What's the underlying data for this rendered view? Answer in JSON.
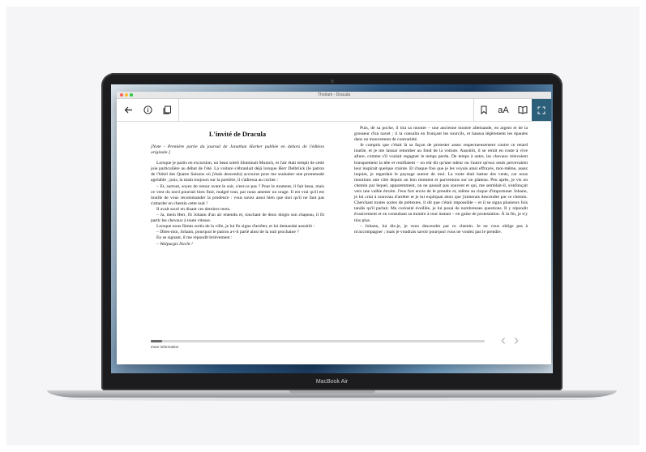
{
  "window": {
    "title": "Thorium - Dracula"
  },
  "toolbar": {
    "back_icon": "arrow-left-icon",
    "info_icon": "info-icon",
    "toc_icon": "library-icon",
    "bookmark_icon": "bookmark-icon",
    "text_settings_label": "aA",
    "reading_mode_icon": "book-open-icon",
    "fullscreen_icon": "fullscreen-icon"
  },
  "book": {
    "left_page": {
      "chapter_title": "L'invité de Dracula",
      "note": "[Note - Première partie du journal de Jonathan Harker publiée en dehors de l'édition originale.]",
      "paragraphs": [
        "Lorsque je partis en excursion, un beau soleil illuminait Munich, et l'air était rempli de cette joie particulière au début de l'été. La voiture s'ébranlait déjà lorsque Herr Delbrück (le patron de l'hôtel des Quatre Saisons où j'étais descendu) accourut pour me souhaiter une promenade agréable ; puis, la main toujours sur la portière, il s'adressa au cocher :",
        "– Et, surtout, soyez de retour avant le soir, n'est-ce pas ? Pour le moment, il fait beau, mais ce vent du nord pourrait bien finir, malgré tout, par nous amener un orage. Il est vrai qu'il est inutile de vous recommander la prudence : vous savez aussi bien que moi qu'il ne faut pas s'attarder en chemin cette nuit !",
        "Il avait souri en disant ces derniers mots.",
        "– Ja, mein Herr, fit Johann d'un air entendu et, touchant de deux doigts son chapeau, il fit partir les chevaux à toute vitesse.",
        "Lorsque nous fûmes sortis de la ville, je lui fis signe d'arrêter, et lui demandai aussitôt :",
        "– Dites-moi, Johann, pourquoi le patron a-t-il parlé ainsi de la nuit prochaine ?",
        "En se signant, il me répondit brièvement :",
        "– Walpurgis Nacht !"
      ]
    },
    "right_page": {
      "paragraphs": [
        "Puis, de sa poche, il tira sa montre – une ancienne montre allemande, en argent et de la grosseur d'un navet ; il la consulta en fronçant les sourcils, et haussa légèrement les épaules dans un mouvement de contrariété.",
        "Je compris que c'était là sa façon de protester assez respectueusement contre ce retard inutile, et je me laissai retomber au fond de la voiture. Aussitôt, il se remit en route à vive allure, comme s'il voulait regagner le temps perdu. De temps à autre, les chevaux relevaient brusquement la tête et reniflaient – on eût dit qu'une odeur ou l'autre qu'eux seuls percevaient leur inspirait quelque crainte. Et chaque fois que je les voyais ainsi effrayés, moi-même, assez inquiet, je regardais le paysage autour de moi. La route était battue des vents, car nous montions une côte depuis un bon moment et parvenions sur un plateau. Peu après, je vis un chemin par lequel, apparemment, on ne passait pas souvent et qui, me semblait-il, s'enfonçait vers une vallée étroite. J'eus fort envie de le prendre et, même au risque d'importuner Johann, je lui criai à nouveau d'arrêter et je lui expliquai alors que j'aimerais descendre par ce chemin. Cherchant toutes sortes de prétextes, il dit que c'était impossible – et il se signa plusieurs fois tandis qu'il parlait. Ma curiosité éveillée, je lui posai de nombreuses questions. Il y répondit évasivement et en consultant sa montre à tout instant – en guise de protestation. À la fin, je n'y tins plus.",
        "– Johann, lui dis-je, je veux descendre par ce chemin. Je ne vous oblige pas à m'accompagner ; mais je voudrais savoir pourquoi vous ne voulez pas le prendre."
      ]
    }
  },
  "footer": {
    "more_info_label": "more information",
    "progress_fraction": 0.035,
    "prev_label": "‹",
    "next_label": "›"
  },
  "device": {
    "label": "MacBook Air"
  }
}
